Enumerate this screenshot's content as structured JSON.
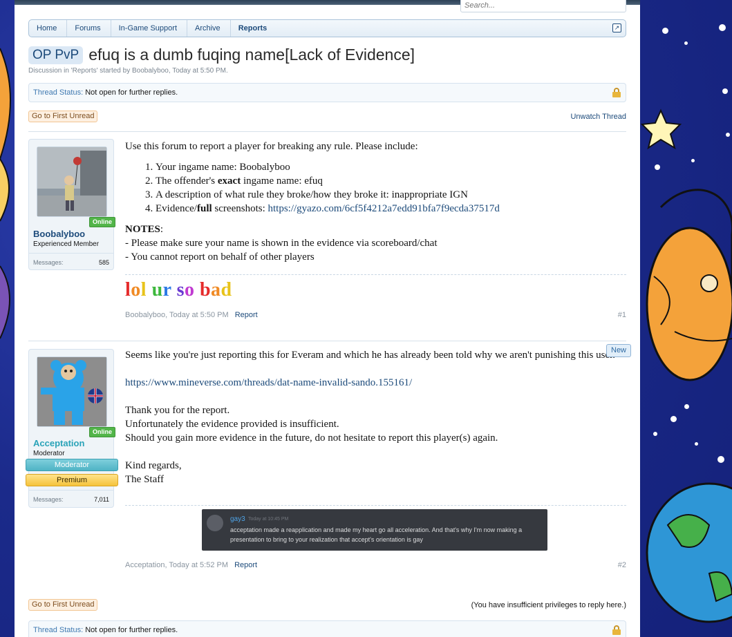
{
  "search": {
    "placeholder": "Search..."
  },
  "breadcrumb": [
    "Home",
    "Forums",
    "In-Game Support",
    "Archive",
    "Reports"
  ],
  "thread": {
    "prefix": "OP PvP",
    "title": "efuq is a dumb fuqing name[Lack of Evidence]",
    "description": "Discussion in 'Reports' started by Boobalyboo, Today at 5:50 PM.",
    "status_label": "Thread Status:",
    "status_value": "Not open for further replies.",
    "first_unread": "Go to First Unread",
    "unwatch": "Unwatch Thread",
    "insufficient": "(You have insufficient privileges to reply here.)"
  },
  "posts": [
    {
      "author": "Boobalyboo",
      "user_title": "Experienced Member",
      "online": "Online",
      "messages_label": "Messages:",
      "messages_count": "585",
      "intro": "Use this forum to report a player for breaking any rule. Please include:",
      "items": [
        {
          "pre": "Your ingame name: ",
          "bold": "",
          "post": "Boobalyboo"
        },
        {
          "pre": "The offender's ",
          "bold": "exact",
          "post": " ingame name: efuq"
        },
        {
          "pre": "A description of what rule they broke/how they broke it: inappropriate IGN",
          "bold": "",
          "post": ""
        },
        {
          "pre": "Evidence/",
          "bold": "full",
          "post": " screenshots: ",
          "link": "https://gyazo.com/6cf5f4212a7edd91bfa7f9ecda37517d"
        }
      ],
      "notes_title": "NOTES",
      "notes": [
        "- Please make sure your name is shown in the evidence via scoreboard/chat",
        "- You cannot report on behalf of other players"
      ],
      "signature": "lol ur so bad",
      "info_author": "Boobalyboo",
      "info_time": "Today at 5:50 PM",
      "report_label": "Report",
      "number": "#1"
    },
    {
      "author": "Acceptation",
      "user_title": "Moderator",
      "online": "Online",
      "banner_mod": "Moderator",
      "banner_premium": "Premium",
      "messages_label": "Messages:",
      "messages_count": "7,011",
      "new_label": "New",
      "line1": "Seems like you're just reporting this for Everam and which he has already been told why we aren't punishing this user.",
      "link": "https://www.mineverse.com/threads/dat-name-invalid-sando.155161/",
      "thanks": "Thank you for the report.",
      "insufficient": "Unfortunately the evidence provided is insufficient.",
      "gain": "Should you gain more evidence in the future, do not hesitate to report this player(s) again.",
      "regards": "Kind regards,",
      "staff": "The Staff",
      "discord": {
        "name": "gay3",
        "time": "Today at 10:45 PM",
        "text": "acceptation made a reapplication and made my heart go all acceleration. And that's why I'm now making a presentation to bring to your realization that accept's orientation is gay"
      },
      "info_author": "Acceptation",
      "info_time": "Today at 5:52 PM",
      "report_label": "Report",
      "number": "#2"
    }
  ],
  "colors": {
    "page_background": "#1c2d8f",
    "link": "#1c4a7a",
    "online_badge": "#52b549",
    "moderator_name": "#2aa3b8",
    "member_name": "#1c4a7a"
  }
}
